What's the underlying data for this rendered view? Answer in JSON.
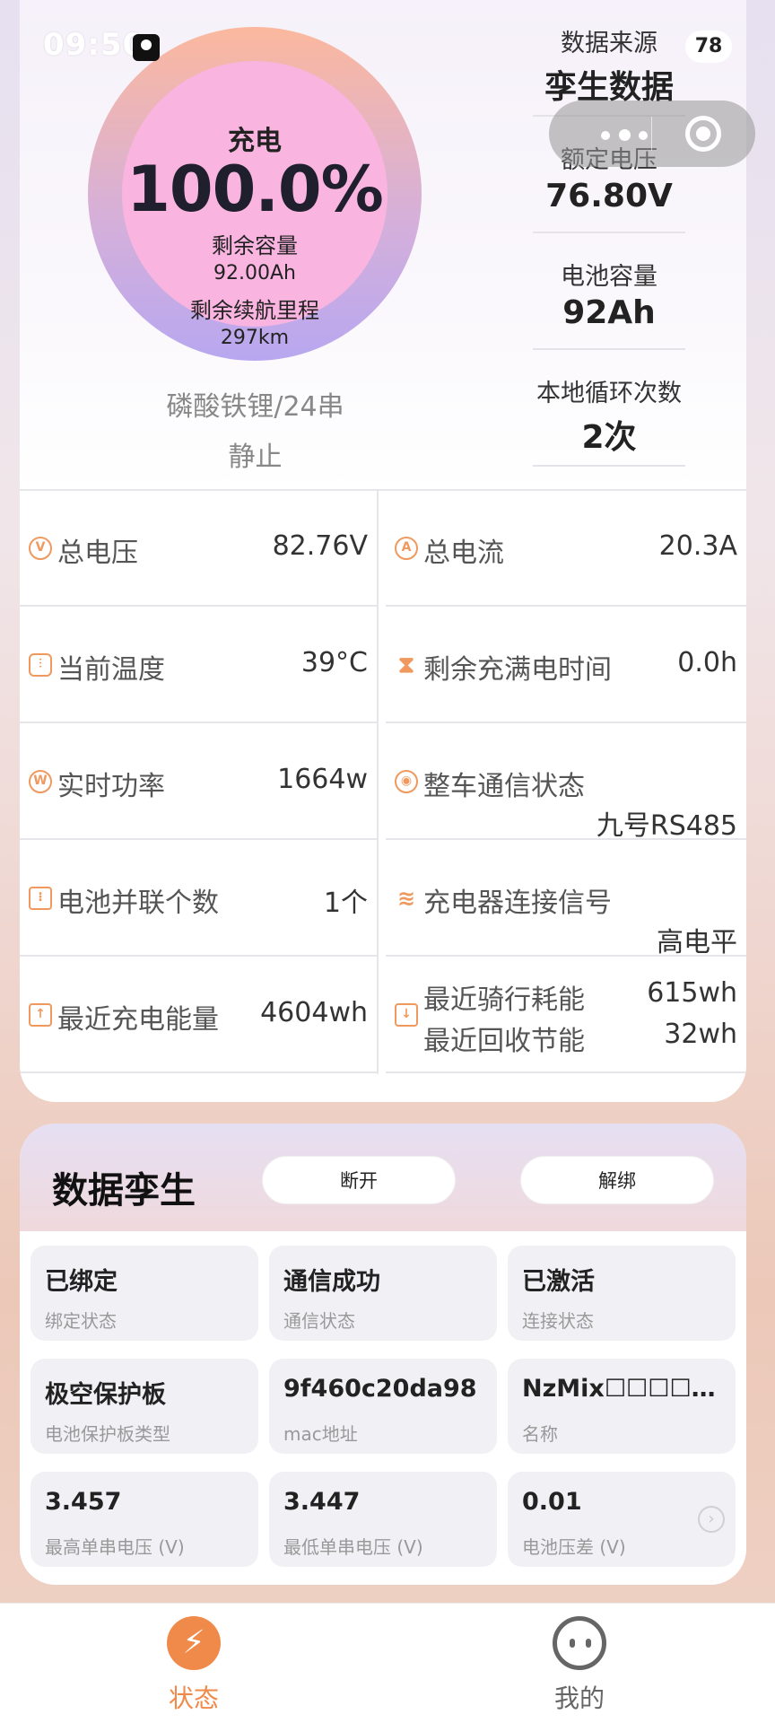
{
  "status_bar": {
    "time": "09:50",
    "battery": "78"
  },
  "gauge": {
    "state": "充电",
    "percent": "100.0%",
    "remaining_label": "剩余容量",
    "remaining_value": "92.00Ah",
    "range_label": "剩余续航里程",
    "range_value": "297km"
  },
  "battery_type": "磷酸铁锂/24串",
  "battery_status": "静止",
  "specs": [
    {
      "label": "数据来源",
      "value": "孪生数据"
    },
    {
      "label": "额定电压",
      "value": "76.80V"
    },
    {
      "label": "电池容量",
      "value": "92Ah"
    },
    {
      "label": "本地循环次数",
      "value": "2次"
    }
  ],
  "metrics": {
    "total_voltage": {
      "label": "总电压",
      "value": "82.76V",
      "icon": "voltage-icon"
    },
    "total_current": {
      "label": "总电流",
      "value": "20.3A",
      "icon": "current-icon"
    },
    "temperature": {
      "label": "当前温度",
      "value": "39°C",
      "icon": "thermometer-icon"
    },
    "full_time": {
      "label": "剩余充满电时间",
      "value": "0.0h",
      "icon": "hourglass-icon"
    },
    "power": {
      "label": "实时功率",
      "value": "1664w",
      "icon": "power-icon"
    },
    "comm_status": {
      "label": "整车通信状态",
      "value": "九号RS485",
      "icon": "signal-icon"
    },
    "parallel": {
      "label": "电池并联个数",
      "value": "1个",
      "icon": "parallel-icon"
    },
    "charger_signal": {
      "label": "充电器连接信号",
      "value": "高电平",
      "icon": "wifi-icon"
    },
    "recent_charge": {
      "label": "最近充电能量",
      "value": "4604wh",
      "icon": "charge-energy-icon"
    },
    "recent_ride": {
      "label": "最近骑行耗能",
      "value": "615wh"
    },
    "recent_recover": {
      "label": "最近回收节能",
      "value": "32wh"
    }
  },
  "twin": {
    "title": "数据孪生",
    "disconnect_label": "断开",
    "unbind_label": "解绑",
    "tiles": [
      {
        "value": "已绑定",
        "label": "绑定状态"
      },
      {
        "value": "通信成功",
        "label": "通信状态"
      },
      {
        "value": "已激活",
        "label": "连接状态"
      },
      {
        "value": "极空保护板",
        "label": "电池保护板类型"
      },
      {
        "value": "9f460c20da98",
        "label": "mac地址"
      },
      {
        "value": "NzMix☐☐☐☐…",
        "label": "名称"
      },
      {
        "value": "3.457",
        "label": "最高单串电压 (V)"
      },
      {
        "value": "3.447",
        "label": "最低单串电压 (V)"
      },
      {
        "value": "0.01",
        "label": "电池压差 (V)"
      }
    ]
  },
  "tabs": [
    {
      "label": "状态",
      "color": "#f08a4a"
    },
    {
      "label": "我的",
      "color": "#666666"
    }
  ]
}
